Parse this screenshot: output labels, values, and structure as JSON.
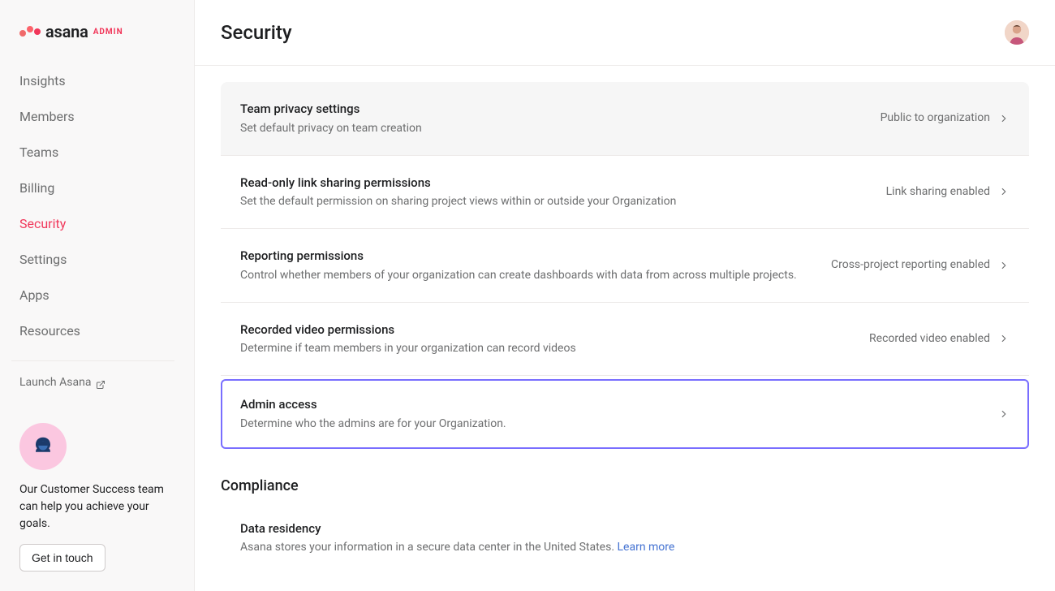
{
  "brand": {
    "word": "asana",
    "admin": "ADMIN"
  },
  "sidebar": {
    "items": [
      {
        "label": "Insights"
      },
      {
        "label": "Members"
      },
      {
        "label": "Teams"
      },
      {
        "label": "Billing"
      },
      {
        "label": "Security"
      },
      {
        "label": "Settings"
      },
      {
        "label": "Apps"
      },
      {
        "label": "Resources"
      }
    ],
    "launch": "Launch Asana",
    "help": {
      "text": "Our Customer Success team can help you achieve your goals.",
      "button": "Get in touch"
    }
  },
  "header": {
    "title": "Security"
  },
  "settings": [
    {
      "title": "Team privacy settings",
      "desc": "Set default privacy on team creation",
      "value": "Public to organization"
    },
    {
      "title": "Read-only link sharing permissions",
      "desc": "Set the default permission on sharing project views within or outside your Organization",
      "value": "Link sharing enabled"
    },
    {
      "title": "Reporting permissions",
      "desc": "Control whether members of your organization can create dashboards with data from across multiple projects.",
      "value": "Cross-project reporting enabled"
    },
    {
      "title": "Recorded video permissions",
      "desc": "Determine if team members in your organization can record videos",
      "value": "Recorded video enabled"
    },
    {
      "title": "Admin access",
      "desc": "Determine who the admins are for your Organization.",
      "value": ""
    }
  ],
  "section2": {
    "heading": "Compliance"
  },
  "compliance": [
    {
      "title": "Data residency",
      "desc_prefix": "Asana stores your information in a secure data center in the United States. ",
      "learn_more": "Learn more"
    }
  ]
}
